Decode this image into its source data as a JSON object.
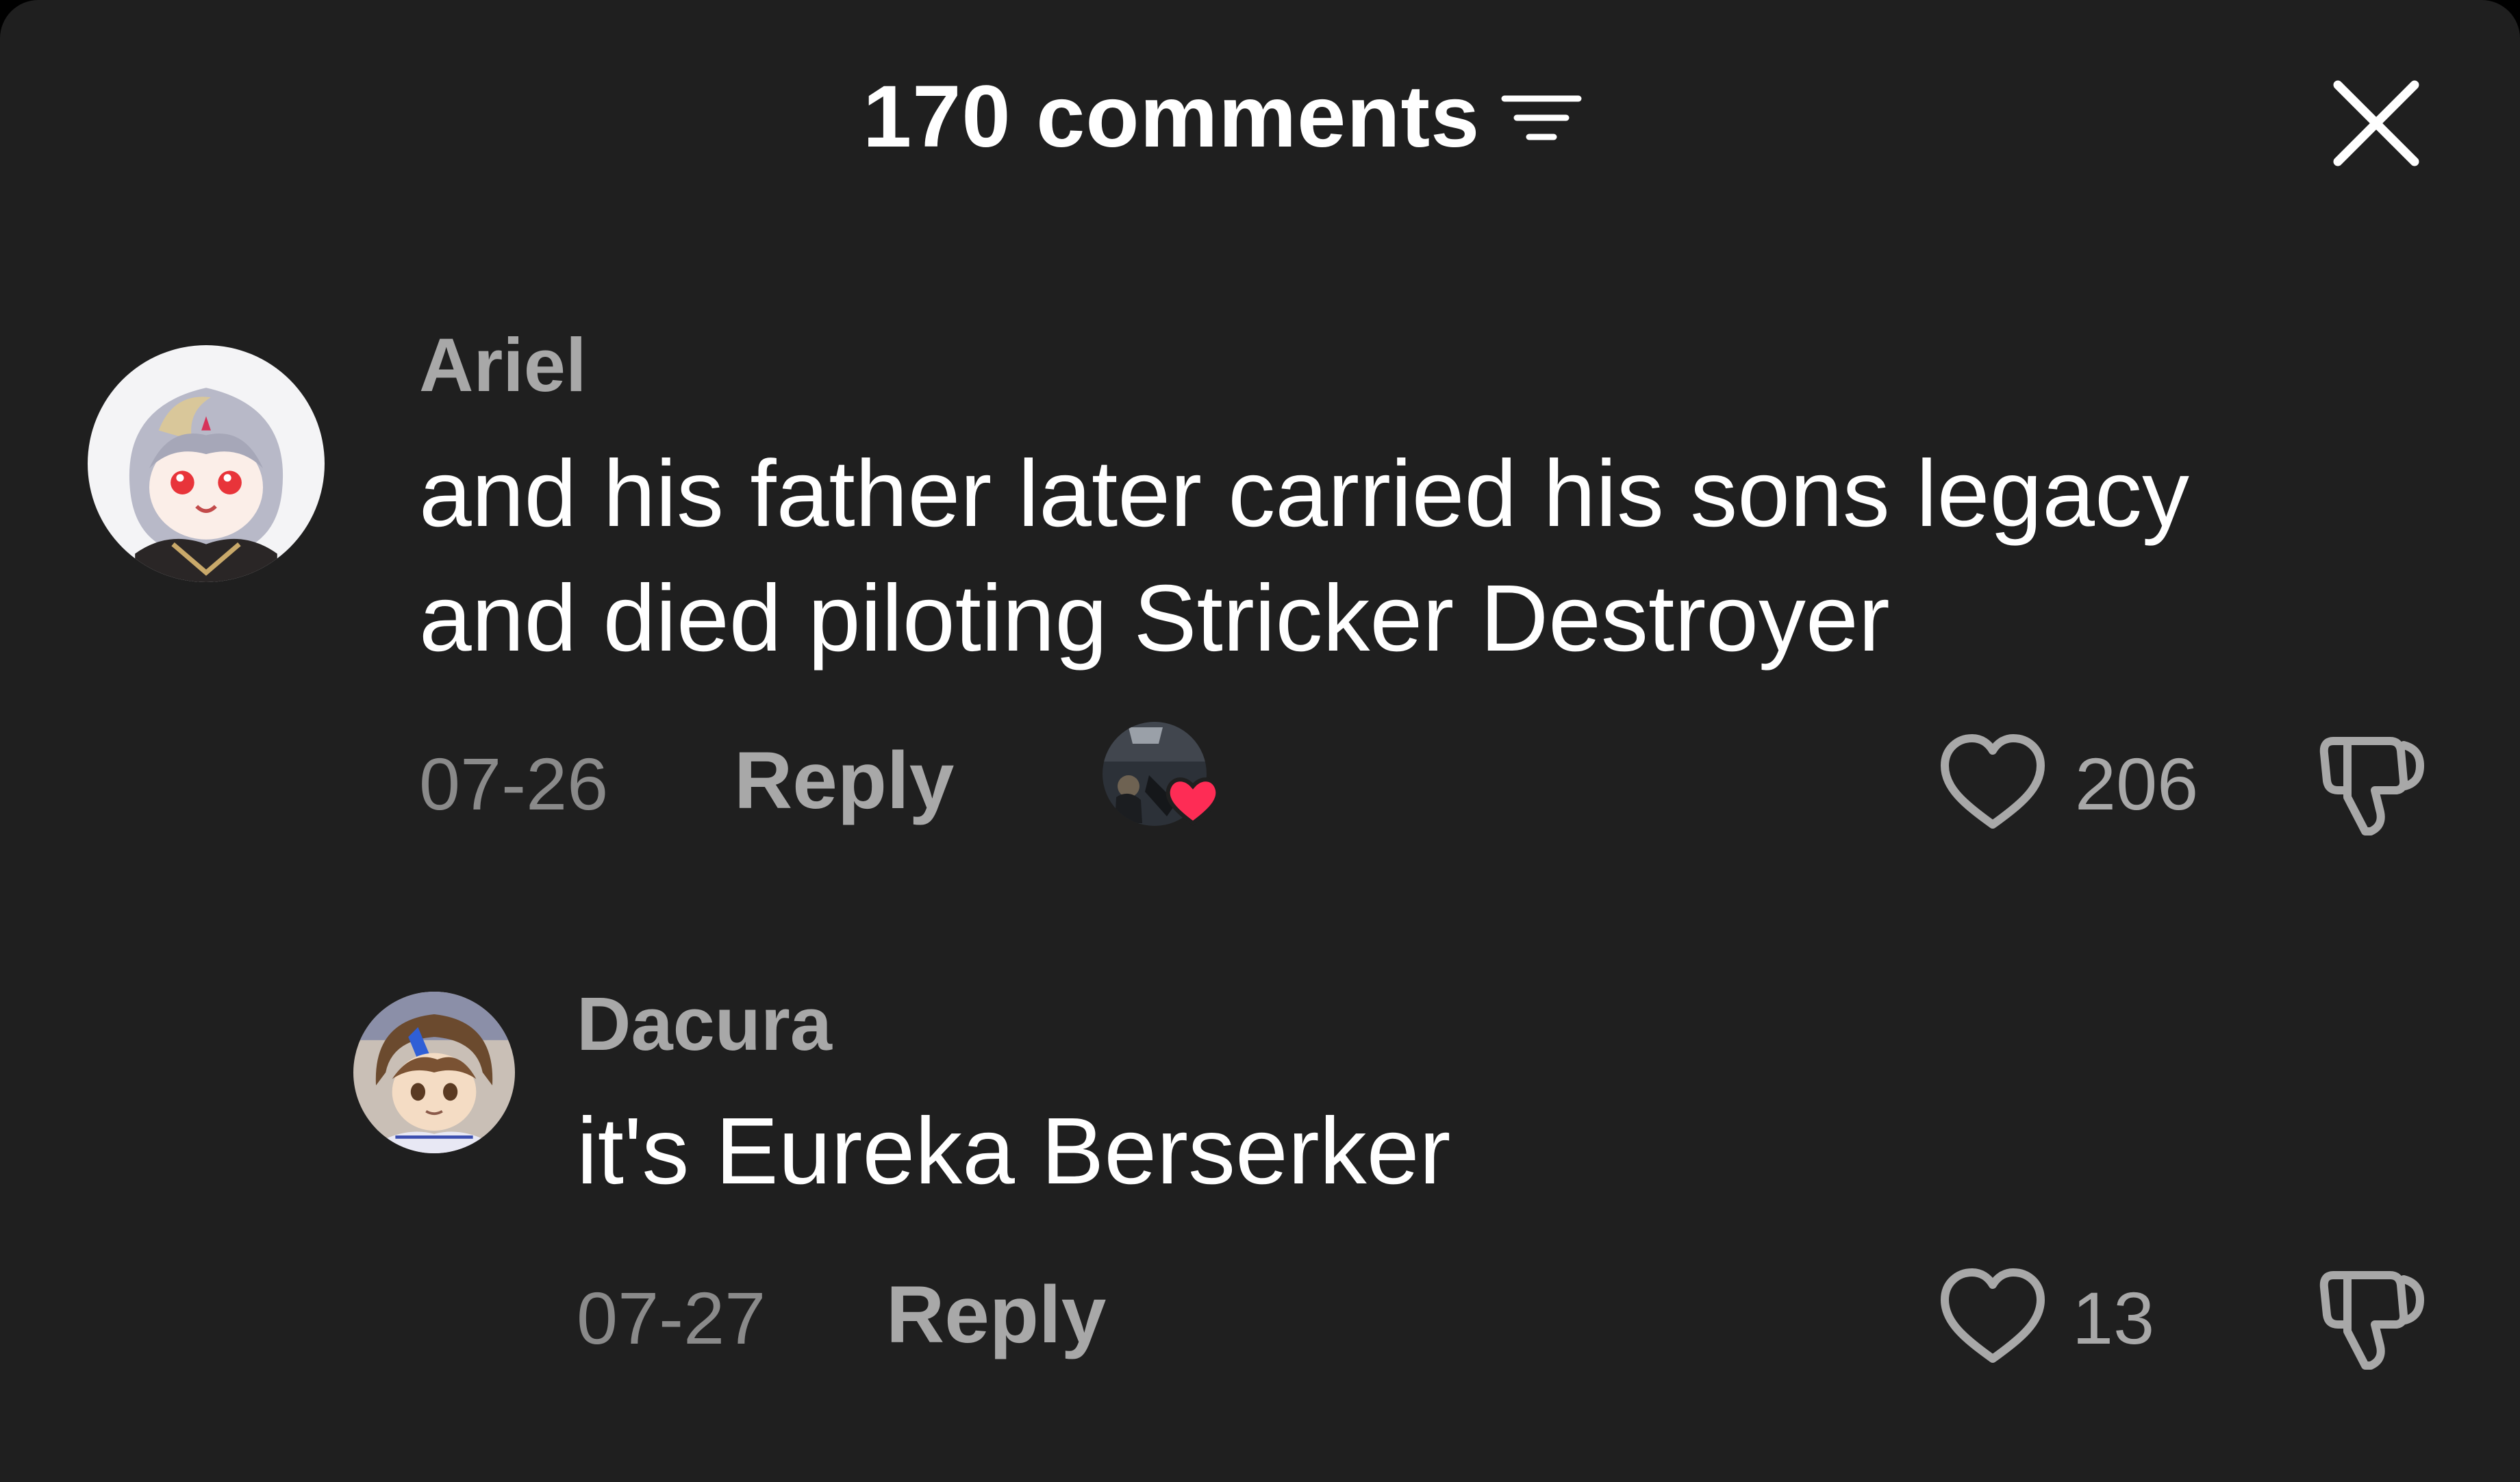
{
  "header": {
    "title": "170 comments",
    "sort_icon": "filter-lines-icon",
    "close_icon": "close-x-icon"
  },
  "comments": [
    {
      "name": "Ariel",
      "text_line1": "and his father later carried his sons legacy",
      "text_line2": "and died piloting Stricker Destroyer",
      "date": "07-26",
      "reply_label": "Reply",
      "likes": "206",
      "liked_by_creator": true
    },
    {
      "name": "Dacura",
      "text_line1": "it's Eureka Berserker",
      "date": "07-27",
      "reply_label": "Reply",
      "likes": "13",
      "liked_by_creator": false
    }
  ],
  "colors": {
    "background": "#1f1f1f",
    "text_primary": "#ffffff",
    "text_secondary": "#a8a8a8",
    "text_muted": "#8a8a8a",
    "heart_badge": "#fe2c55"
  }
}
